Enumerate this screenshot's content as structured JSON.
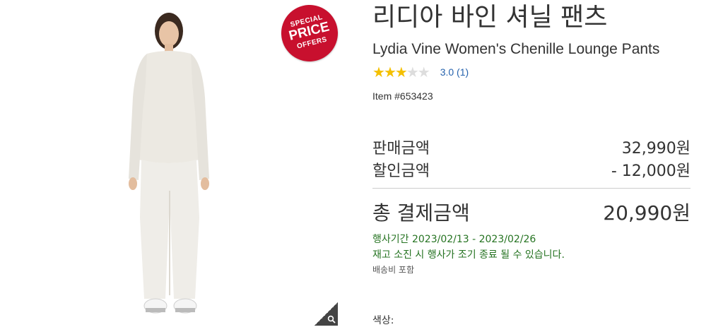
{
  "badge": {
    "line1": "SPECIAL",
    "line2": "PRICE",
    "line3": "OFFERS",
    "color": "#c8102e"
  },
  "product": {
    "title_ko": "리디아 바인 셔닐 팬츠",
    "title_en": "Lydia Vine Women's Chenille Lounge Pants",
    "rating": {
      "value": 3.0,
      "max": 5,
      "text": "3.0 (1)"
    },
    "item_number": "Item #653423"
  },
  "pricing": {
    "rows": [
      {
        "label": "판매금액",
        "value": "32,990원"
      },
      {
        "label": "할인금액",
        "value": "- 12,000원"
      }
    ],
    "total": {
      "label": "총 결제금액",
      "value": "20,990원"
    }
  },
  "promo": {
    "period": "행사기간 2023/02/13 - 2023/02/26",
    "note": "재고 소진 시 행사가 조기 종료 될 수 있습니다.",
    "color": "#257321"
  },
  "shipping": "배송비 포함",
  "options": {
    "color_label": "색상:"
  },
  "icons": {
    "zoom": "zoom-magnifier-icon",
    "star_filled": "star-filled-icon",
    "star_empty": "star-empty-icon"
  },
  "colors": {
    "star_on": "#f4c000",
    "star_off": "#dddddd",
    "link": "#2562ad",
    "text": "#333333"
  }
}
